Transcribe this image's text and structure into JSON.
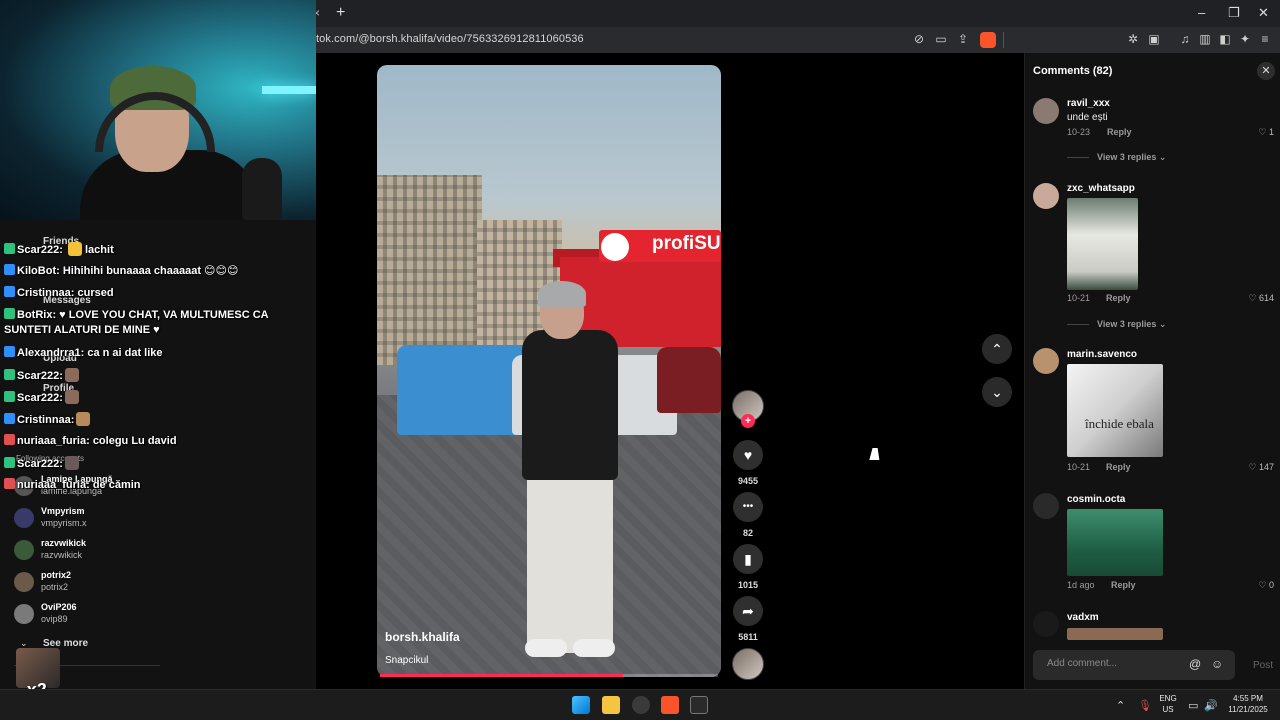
{
  "browser": {
    "url": "tok.com/@borsh.khalifa/video/7563326912811060536",
    "tab_close_glyph": "×",
    "new_tab_glyph": "+",
    "window_controls": [
      "–",
      "❐",
      "✕"
    ]
  },
  "video": {
    "author": "borsh.khalifa",
    "caption": "Snapcikul",
    "progress_fraction": 0.72,
    "store_sign_text": "profiSU",
    "actions": [
      {
        "icon": "heart-icon",
        "glyph": "♥",
        "count": "9455"
      },
      {
        "icon": "comment-icon",
        "glyph": "•••",
        "count": "82"
      },
      {
        "icon": "bookmark-icon",
        "glyph": "▮",
        "count": "1015"
      },
      {
        "icon": "share-icon",
        "glyph": "➦",
        "count": "5811"
      }
    ],
    "nav_up_glyph": "⌃",
    "nav_down_glyph": "⌄"
  },
  "comments": {
    "title": "Comments (82)",
    "close_glyph": "✕",
    "items": [
      {
        "user": "ravil_xxx",
        "text": "unde ești",
        "date": "10-23",
        "reply": "Reply",
        "likes": "1",
        "view_replies": "View 3 replies"
      },
      {
        "user": "zxc_whatsapp",
        "text": "",
        "date": "10-21",
        "reply": "Reply",
        "likes": "614",
        "view_replies": "View 3 replies"
      },
      {
        "user": "marin.savenco",
        "text": "",
        "image_text": "închide ebala",
        "date": "10-21",
        "reply": "Reply",
        "likes": "147"
      },
      {
        "user": "cosmin.octa",
        "text": "",
        "date": "1d ago",
        "reply": "Reply",
        "likes": "0"
      },
      {
        "user": "vadxm",
        "text": ""
      }
    ],
    "add_placeholder": "Add comment...",
    "mention_glyph": "@",
    "emoji_glyph": "☺",
    "post_label": "Post"
  },
  "sidebar": {
    "items": [
      "Friends",
      "Messages",
      "Upload",
      "Profile"
    ],
    "following_label": "Following accounts",
    "following": [
      {
        "name": "Lamine Lapungă",
        "handle": "lamine.lapunga"
      },
      {
        "name": "Vmpyrism",
        "handle": "vmpyrism.x"
      },
      {
        "name": "razvwikick",
        "handle": "razvwikick"
      },
      {
        "name": "potrix2",
        "handle": "potrix2"
      },
      {
        "name": "OviP206",
        "handle": "ovip89"
      }
    ],
    "see_more": "See more"
  },
  "chat": {
    "lines": [
      {
        "user": "Scar222:",
        "user_color": "#ffffff",
        "text": "lachit"
      },
      {
        "user": "KiloBot:",
        "user_color": "#ff5a5a",
        "text": "Hihihihi bunaaaa chaaaaat 😊😊😊"
      },
      {
        "user": "Cristinnaa:",
        "user_color": "#c68bff",
        "text": "cursed"
      },
      {
        "user": "BotRix:",
        "user_color": "#b7ff4a",
        "text": "♥ LOVE YOU CHAT, VA MULTUMESC CA"
      },
      {
        "user": "",
        "user_color": "#ffffff",
        "text": "SUNTETI ALATURI DE MINE ♥"
      },
      {
        "user": "Alexandrra1:",
        "user_color": "#61d4ff",
        "text": "ca n ai dat like"
      },
      {
        "user": "Scar222:",
        "user_color": "#ffffff",
        "text": ""
      },
      {
        "user": "Scar222:",
        "user_color": "#ffffff",
        "text": ""
      },
      {
        "user": "Cristinnaa:",
        "user_color": "#c68bff",
        "text": ""
      },
      {
        "user": "nuriaaa_furia:",
        "user_color": "#ff6b9a",
        "text": "colegu Lu david"
      },
      {
        "user": "Scar222:",
        "user_color": "#ffffff",
        "text": ""
      },
      {
        "user": "nuriaaa_furia:",
        "user_color": "#ff6b9a",
        "text": "de cămin"
      }
    ],
    "multiplier": "x2"
  },
  "taskbar": {
    "lang_top": "ENG",
    "lang_bottom": "US",
    "time": "4:55 PM",
    "date": "11/21/2025",
    "chevron_glyph": "⌃"
  },
  "colors": {
    "accent": "#fe2c55",
    "panel_bg": "#121212",
    "brave": "#fb542b"
  }
}
